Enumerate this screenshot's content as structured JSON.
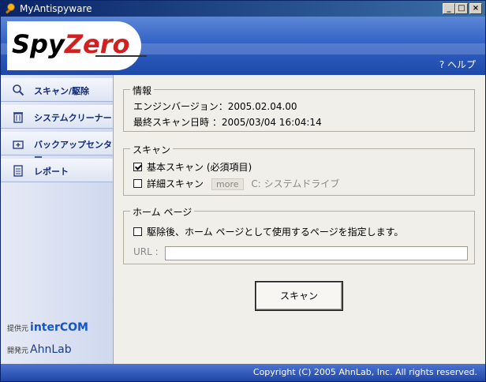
{
  "window": {
    "title": "MyAntispyware",
    "minimize": "_",
    "maximize": "□",
    "close": "×"
  },
  "header": {
    "logo_text": "SpyZero",
    "help_label": "? ヘルプ"
  },
  "sidebar": {
    "items": [
      {
        "label": "スキャン/駆除",
        "icon": "magnifier-icon"
      },
      {
        "label": "システムクリーナー",
        "icon": "trash-icon"
      },
      {
        "label": "バックアップセンター",
        "icon": "backup-icon"
      },
      {
        "label": "レポート",
        "icon": "report-icon"
      }
    ],
    "provider_label": "提供元",
    "provider_name": "interCOM",
    "developer_label": "開発元",
    "developer_name": "AhnLab"
  },
  "info": {
    "title": "情報",
    "engine_label": "エンジンバージョン：",
    "engine_value": "2005.02.04.00",
    "lastscan_label": "最終スキャン日時 ：",
    "lastscan_value": "2005/03/04 16:04:14"
  },
  "scan": {
    "title": "スキャン",
    "basic_label": "基本スキャン (必須項目)",
    "basic_checked": true,
    "detail_label": "詳細スキャン",
    "detail_checked": false,
    "more_label": "more",
    "drive_label": "C: システムドライブ"
  },
  "homepage": {
    "title": "ホーム ページ",
    "option_label": "駆除後、ホーム ページとして使用するページを指定します。",
    "option_checked": false,
    "url_label": "URL :",
    "url_value": ""
  },
  "actions": {
    "scan_label": "スキャン"
  },
  "footer": {
    "copyright": "Copyright (C) 2005 AhnLab, Inc. All rights reserved."
  },
  "colors": {
    "accent": "#2f5fc4",
    "logo_red": "#d21f1f",
    "nav_text": "#102a7a"
  }
}
